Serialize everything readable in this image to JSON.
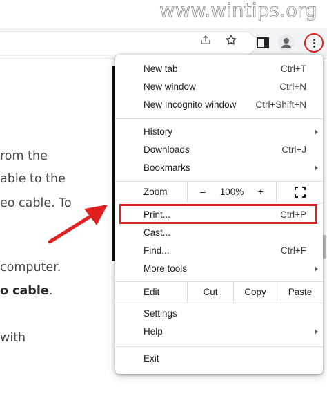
{
  "watermark": "www.wintips.org",
  "page": {
    "lines": [
      {
        "text": "rom the",
        "bold": ""
      },
      {
        "text": "able to the",
        "bold": ""
      },
      {
        "text": "eo cable. To",
        "bold": ""
      },
      {
        "text": "computer.",
        "bold": ""
      },
      {
        "text": "",
        "bold": "o cable",
        "after": "."
      },
      {
        "text": "with",
        "bold": ""
      }
    ]
  },
  "toolbar": {
    "icons": [
      "share-icon",
      "star-icon",
      "side-panel-icon",
      "profile-icon",
      "kebab-menu-icon"
    ]
  },
  "menu": {
    "group1": [
      {
        "label": "New tab",
        "shortcut": "Ctrl+T"
      },
      {
        "label": "New window",
        "shortcut": "Ctrl+N"
      },
      {
        "label": "New Incognito window",
        "shortcut": "Ctrl+Shift+N"
      }
    ],
    "group2": [
      {
        "label": "History",
        "shortcut": ""
      },
      {
        "label": "Downloads",
        "shortcut": "Ctrl+J"
      },
      {
        "label": "Bookmarks",
        "shortcut": ""
      }
    ],
    "zoom": {
      "label": "Zoom",
      "minus": "–",
      "value": "100%",
      "plus": "+"
    },
    "group3": [
      {
        "label": "Print...",
        "shortcut": "Ctrl+P"
      },
      {
        "label": "Cast...",
        "shortcut": ""
      },
      {
        "label": "Find...",
        "shortcut": "Ctrl+F"
      },
      {
        "label": "More tools",
        "shortcut": ""
      }
    ],
    "edit": {
      "label": "Edit",
      "cut": "Cut",
      "copy": "Copy",
      "paste": "Paste"
    },
    "group4": [
      {
        "label": "Settings",
        "shortcut": ""
      },
      {
        "label": "Help",
        "shortcut": ""
      }
    ],
    "exit": {
      "label": "Exit"
    }
  },
  "colors": {
    "highlight": "#e0201e",
    "menu_bg": "#ffffff",
    "toolbar_bg": "#f1f3f4"
  }
}
